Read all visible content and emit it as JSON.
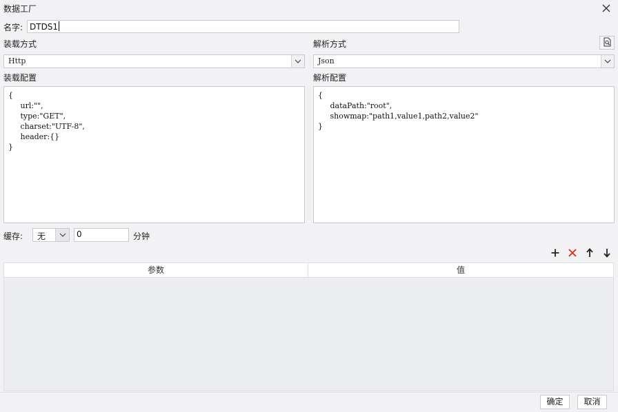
{
  "window": {
    "title": "数据工厂"
  },
  "name_row": {
    "label": "名字:",
    "value": "DTDS1"
  },
  "load": {
    "method_label": "装载方式",
    "method_value": "Http",
    "config_label": "装载配置",
    "config_text": "{\n     url:\"\",\n     type:\"GET\",\n     charset:\"UTF-8\",\n     header:{}\n}"
  },
  "parse": {
    "method_label": "解析方式",
    "method_value": "Json",
    "config_label": "解析配置",
    "config_text": "{\n     dataPath:\"root\",\n     showmap:\"path1,value1,path2,value2\"\n}"
  },
  "cache": {
    "label": "缓存:",
    "option_value": "无",
    "amount_value": "0",
    "unit_label": "分钟"
  },
  "params_table": {
    "columns": [
      "参数",
      "值"
    ],
    "rows": []
  },
  "toolbar_icons": [
    "add-icon",
    "delete-icon",
    "move-up-icon",
    "move-down-icon",
    "preview-icon"
  ],
  "colors": {
    "delete": "#e0271c",
    "background": "#f2f2f5"
  },
  "footer": {
    "ok_label": "确定",
    "cancel_label": "取消"
  }
}
